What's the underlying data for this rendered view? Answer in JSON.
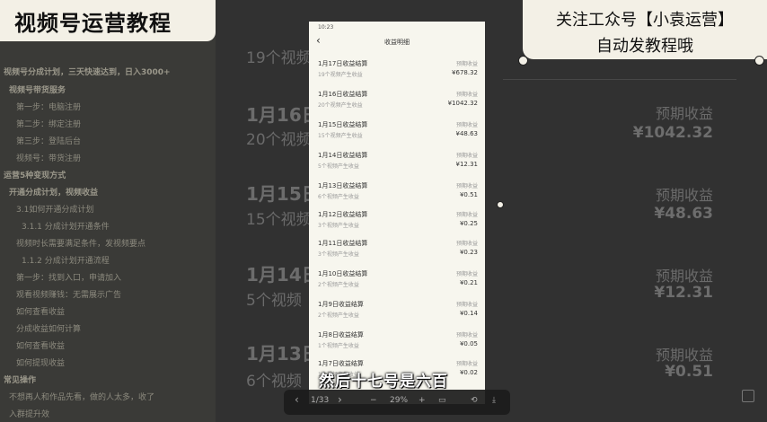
{
  "title_badge": "视频号运营教程",
  "follow_badge": {
    "line1": "关注工众号【小袁运营】",
    "line2": "自动发教程哦"
  },
  "outline": [
    "视频号分成计划，三天快速达到，日入3000+",
    "视频号带货服务",
    "第一步：电脑注册",
    "第二步：绑定注册",
    "第三步：登陆后台",
    "视频号：带货注册",
    "运营5种变现方式",
    "开通分成计划，视频收益",
    "3.1如何开通分成计划",
    "3.1.1 分成计划开通条件",
    "视频时长需要满足条件，发视频要点",
    "1.1.2 分成计划开通流程",
    "第一步：找到入口，申请加入",
    "观看视频赚钱：无需展示广告",
    "如何查看收益",
    "分成收益如何计算",
    "如何查看收益",
    "如何提现收益",
    "常见操作",
    "不想再人和作品先看，做的人太多，收了",
    "入群提升效"
  ],
  "doc_rows": [
    {
      "date": "",
      "count": "19个视频",
      "label": "",
      "value": ""
    },
    {
      "date": "1月16日",
      "count": "20个视频",
      "label": "预期收益",
      "value": "¥1042.32"
    },
    {
      "date": "1月15日",
      "count": "15个视频",
      "label": "预期收益",
      "value": "¥48.63"
    },
    {
      "date": "1月14日",
      "count": "5个视频",
      "label": "预期收益",
      "value": "¥12.31"
    },
    {
      "date": "1月13日",
      "count": "6个视频",
      "label": "预期收益",
      "value": "¥0.51"
    }
  ],
  "phone": {
    "status": "10:23",
    "title": "收益明细",
    "entries": [
      {
        "title": "1月17日收益结算",
        "sub": "19个视频产生收益",
        "right_top": "预期收益",
        "right_value": "¥678.32"
      },
      {
        "title": "1月16日收益结算",
        "sub": "20个视频产生收益",
        "right_top": "预期收益",
        "right_value": "¥1042.32"
      },
      {
        "title": "1月15日收益结算",
        "sub": "15个视频产生收益",
        "right_top": "预期收益",
        "right_value": "¥48.63"
      },
      {
        "title": "1月14日收益结算",
        "sub": "5个视频产生收益",
        "right_top": "预期收益",
        "right_value": "¥12.31"
      },
      {
        "title": "1月13日收益结算",
        "sub": "6个视频产生收益",
        "right_top": "预期收益",
        "right_value": "¥0.51"
      },
      {
        "title": "1月12日收益结算",
        "sub": "3个视频产生收益",
        "right_top": "预期收益",
        "right_value": "¥0.25"
      },
      {
        "title": "1月11日收益结算",
        "sub": "3个视频产生收益",
        "right_top": "预期收益",
        "right_value": "¥0.23"
      },
      {
        "title": "1月10日收益结算",
        "sub": "2个视频产生收益",
        "right_top": "预期收益",
        "right_value": "¥0.21"
      },
      {
        "title": "1月9日收益结算",
        "sub": "2个视频产生收益",
        "right_top": "预期收益",
        "right_value": "¥0.14"
      },
      {
        "title": "1月8日收益结算",
        "sub": "1个视频产生收益",
        "right_top": "预期收益",
        "right_value": "¥0.05"
      },
      {
        "title": "1月7日收益结算",
        "sub": "1个视频产生收益",
        "right_top": "预期收益",
        "right_value": "¥0.02"
      }
    ]
  },
  "subtitle": "然后十七号是六百",
  "toolbar": {
    "prev": "‹",
    "page": "1/33",
    "next": "›",
    "zoom_out": "−",
    "zoom": "29%",
    "zoom_in": "+",
    "fit": "▭",
    "rotate": "⟲",
    "download": "⤓"
  }
}
